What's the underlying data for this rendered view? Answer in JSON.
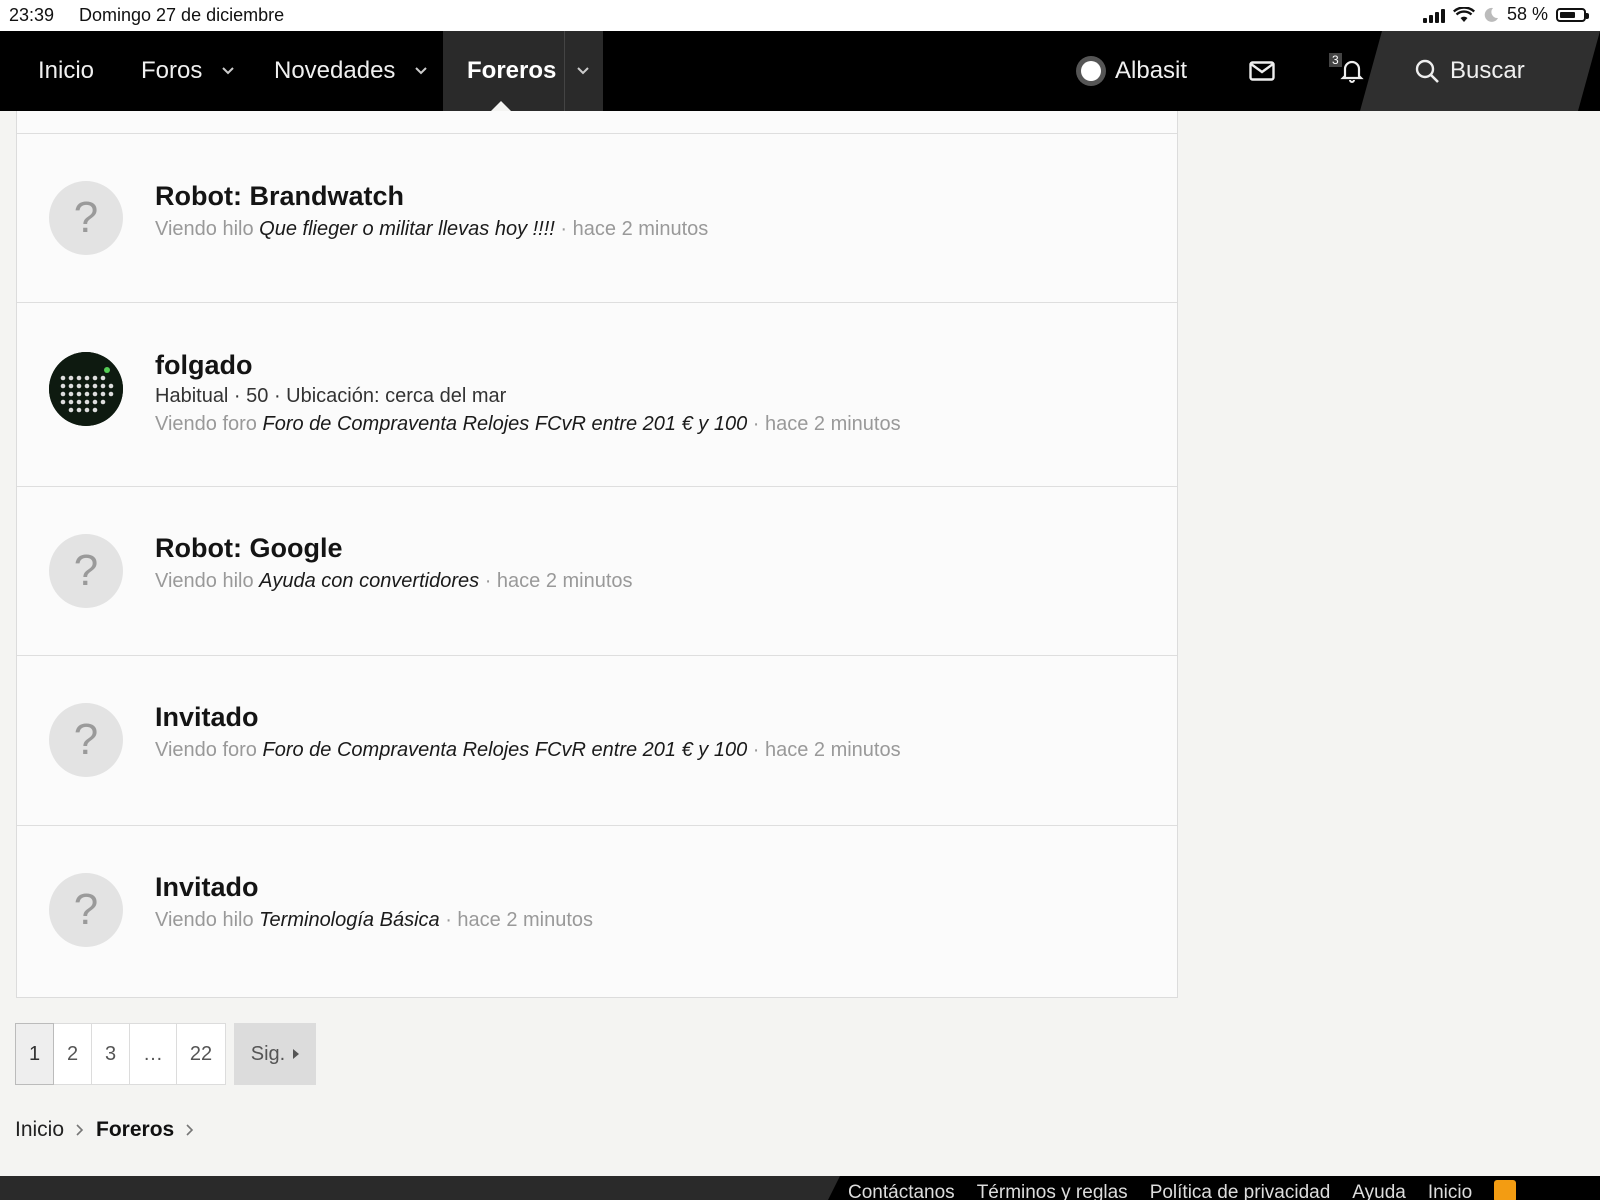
{
  "status": {
    "time": "23:39",
    "date": "Domingo 27 de diciembre",
    "battery": "58 %"
  },
  "nav": {
    "inicio": "Inicio",
    "foros": "Foros",
    "novedades": "Novedades",
    "foreros": "Foreros",
    "user": "Albasit",
    "alerts_count": "3",
    "search": "Buscar"
  },
  "rows": [
    {
      "name": "Robot: Brandwatch",
      "action": "Viendo hilo",
      "target": "Que flieger o militar llevas hoy !!!!",
      "time": "· hace 2 minutos"
    },
    {
      "name": "folgado",
      "meta": "Habitual · 50 · Ubicación: cerca del mar",
      "action": "Viendo foro",
      "target": "Foro de Compraventa Relojes FCvR entre 201 € y 100",
      "time": "· hace 2 minutos"
    },
    {
      "name": "Robot: Google",
      "action": "Viendo hilo",
      "target": "Ayuda con convertidores",
      "time": "· hace 2 minutos"
    },
    {
      "name": "Invitado",
      "action": "Viendo foro",
      "target": "Foro de Compraventa Relojes FCvR entre 201 € y 100",
      "time": "· hace 2 minutos"
    },
    {
      "name": "Invitado",
      "action": "Viendo hilo",
      "target": "Terminología Básica",
      "time": "· hace 2 minutos"
    }
  ],
  "avatar_placeholder": "?",
  "pager": {
    "p1": "1",
    "p2": "2",
    "p3": "3",
    "ellipsis": "…",
    "last": "22",
    "next": "Sig."
  },
  "breadcrumb": {
    "home": "Inicio",
    "current": "Foreros"
  },
  "footer": {
    "contact": "Contáctanos",
    "terms": "Términos y reglas",
    "privacy": "Política de privacidad",
    "help": "Ayuda",
    "home": "Inicio"
  }
}
